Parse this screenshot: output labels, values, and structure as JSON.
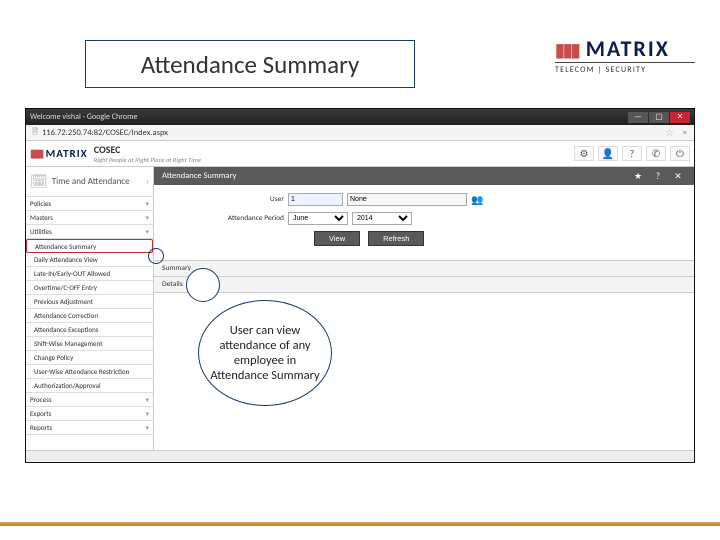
{
  "slide": {
    "title": "Attendance Summary",
    "logo_brand": "MATRIX",
    "logo_sub": "TELECOM | SECURITY"
  },
  "browser": {
    "window_title": "Welcome vishal - Google Chrome",
    "address": "116.72.250.74:82/COSEC/Index.aspx"
  },
  "app": {
    "logo": "MATRIX",
    "product": "COSEC",
    "tagline": "Right People at Right Place at Right Time"
  },
  "sidebar": {
    "head": "Time and Attendance",
    "items": [
      {
        "label": "Policies",
        "expand": true
      },
      {
        "label": "Masters",
        "expand": true
      },
      {
        "label": "Utilities",
        "expand": true
      },
      {
        "label": "Attendance Summary",
        "selected": true
      },
      {
        "label": "Daily Attendance View"
      },
      {
        "label": "Late-IN/Early-OUT Allowed"
      },
      {
        "label": "Overtime/C-OFF Entry"
      },
      {
        "label": "Previous Adjustment"
      },
      {
        "label": "Attendance Correction"
      },
      {
        "label": "Attendance Exceptions"
      },
      {
        "label": "Shift-Wise Management"
      },
      {
        "label": "Change Policy"
      },
      {
        "label": "User-Wise Attendance Restriction"
      },
      {
        "label": "Authorization/Approval"
      },
      {
        "label": "Process",
        "expand": true
      },
      {
        "label": "Exports",
        "expand": true
      },
      {
        "label": "Reports",
        "expand": true
      }
    ]
  },
  "content": {
    "title": "Attendance Summary",
    "form": {
      "user_label": "User",
      "user_value": "1",
      "user_name": "None",
      "period_label": "Attendance Period",
      "month": "June",
      "year": "2014",
      "view_btn": "View",
      "refresh_btn": "Refresh"
    },
    "tabs": [
      "Summary",
      "Details"
    ]
  },
  "callout": {
    "text": "User can view attendance of any employee in Attendance Summary"
  }
}
